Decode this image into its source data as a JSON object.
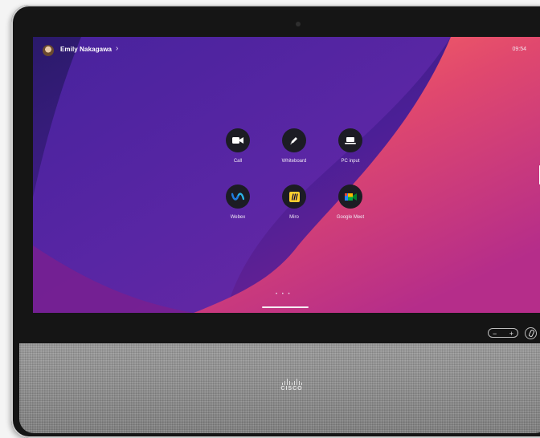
{
  "status": {
    "user_name": "Emily Nakagawa",
    "chevron": "›",
    "time": "09:54"
  },
  "apps": [
    {
      "label": "Call",
      "icon": "video-camera-icon"
    },
    {
      "label": "Whiteboard",
      "icon": "pencil-icon"
    },
    {
      "label": "PC input",
      "icon": "laptop-icon"
    },
    {
      "label": "Webex",
      "icon": "webex-icon"
    },
    {
      "label": "Miro",
      "icon": "miro-icon"
    },
    {
      "label": "Google Meet",
      "icon": "google-meet-icon"
    }
  ],
  "pager": "• • •",
  "controls": {
    "volume_minus": "−",
    "volume_plus": "+"
  },
  "brand": {
    "logo_text": "CISCO"
  },
  "colors": {
    "wallpaper_purple": "#5a22a0",
    "wallpaper_pink": "#c5367f",
    "wallpaper_orange": "#ff6b5a",
    "app_button": "#1c1c24",
    "miro_yellow": "#ffd02f"
  }
}
